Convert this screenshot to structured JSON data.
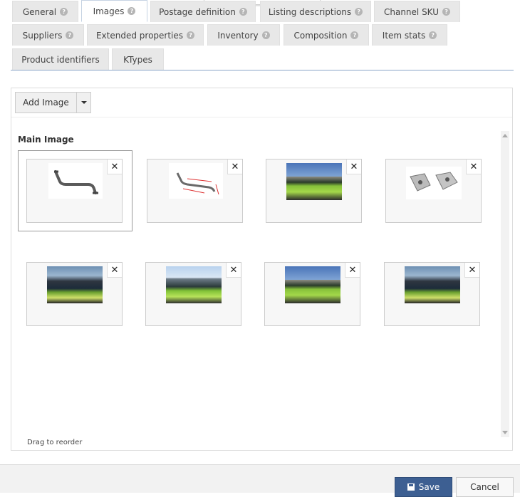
{
  "tabs": [
    {
      "label": "General",
      "help": true
    },
    {
      "label": "Images",
      "help": true,
      "active": true
    },
    {
      "label": "Postage definition",
      "help": true
    },
    {
      "label": "Listing descriptions",
      "help": true
    },
    {
      "label": "Channel SKU",
      "help": true
    },
    {
      "label": "Suppliers",
      "help": true
    },
    {
      "label": "Extended properties",
      "help": true
    },
    {
      "label": "Inventory",
      "help": true
    },
    {
      "label": "Composition",
      "help": true
    },
    {
      "label": "Item stats",
      "help": true
    },
    {
      "label": "Product identifiers",
      "help": false
    },
    {
      "label": "KTypes",
      "help": false
    }
  ],
  "toolbar": {
    "add_image_label": "Add Image",
    "dropdown_icon": "caret-down-icon"
  },
  "images_section": {
    "main_image_label": "Main Image",
    "drag_hint": "Drag to reorder",
    "remove_icon": "close-icon",
    "thumbnails": [
      {
        "kind": "roof-bar-product",
        "selected": true
      },
      {
        "kind": "roof-bar-dimensions"
      },
      {
        "kind": "vehicle-photo"
      },
      {
        "kind": "mounting-brackets"
      },
      {
        "kind": "vehicle-photo"
      },
      {
        "kind": "vehicle-photo"
      },
      {
        "kind": "vehicle-photo"
      },
      {
        "kind": "vehicle-photo"
      }
    ]
  },
  "footer": {
    "save_label": "Save",
    "cancel_label": "Cancel",
    "save_icon": "floppy-disk-icon"
  },
  "colors": {
    "primary_button": "#3d5f92",
    "tab_background": "#e8e8e8",
    "tab_underline": "#8aa4c8"
  }
}
